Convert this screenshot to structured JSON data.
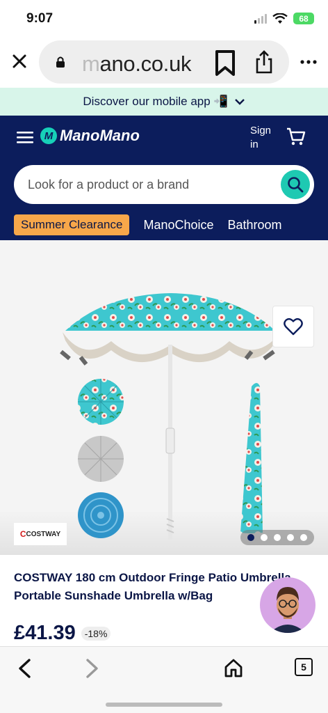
{
  "status_bar": {
    "time": "9:07",
    "battery": "68"
  },
  "browser": {
    "url_faded": "m",
    "url": "ano.co.uk",
    "tab_count": "5"
  },
  "app_banner": {
    "text": "Discover our mobile app 📲",
    "chevron": "⌄"
  },
  "header": {
    "logo_letter": "M",
    "logo_text": "ManoMano",
    "sign_in_line1": "Sign",
    "sign_in_line2": "in"
  },
  "search": {
    "placeholder": "Look for a product or a brand"
  },
  "nav": {
    "items": [
      "Summer Clearance",
      "ManoChoice",
      "Bathroom"
    ],
    "highlight_color": "#f7a74a"
  },
  "product": {
    "brand_logo_text": "COSTWAY",
    "brand_logo_initial": "C",
    "image_count": 5,
    "active_image_index": 0,
    "title": "COSTWAY 180 cm Outdoor Fringe Patio Umbrella Portable Sunshade Umbrella w/Bag",
    "price": "£41.39",
    "discount": "-18%"
  },
  "colors": {
    "navy": "#0c1d5c",
    "teal": "#1ec9b2",
    "banner_bg": "#d8f5ea"
  },
  "icons": [
    "close-icon",
    "lock-icon",
    "bookmark-icon",
    "share-icon",
    "more-icon",
    "menu-icon",
    "cart-icon",
    "search-icon",
    "heart-icon",
    "back-icon",
    "forward-icon",
    "home-icon",
    "tabs-icon"
  ]
}
